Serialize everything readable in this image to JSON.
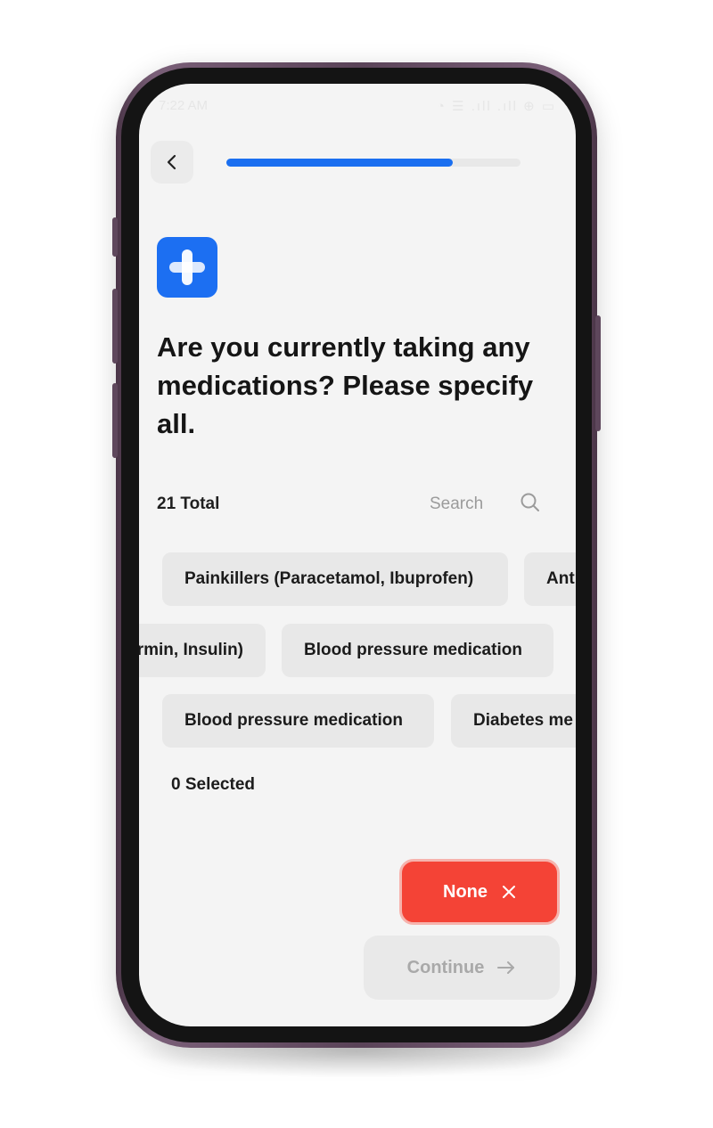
{
  "status_bar": {
    "time": "7:22 AM",
    "icons": "◔ ☰ .ıll .ıll ⊕ ▭"
  },
  "header": {
    "back_icon": "chevron-left-icon",
    "progress_fraction": 0.77
  },
  "question": {
    "icon": "medical-cross-icon",
    "text": "Are you currently taking any medications? Please specify all."
  },
  "list_header": {
    "total_label": "21 Total",
    "search_placeholder": "Search",
    "search_icon": "search-icon"
  },
  "chips": {
    "row1": [
      "Painkillers (Paracetamol, Ibuprofen)",
      "Ant"
    ],
    "row2": [
      "rmin, Insulin)",
      "Blood pressure medication"
    ],
    "row3": [
      "Blood pressure medication",
      "Diabetes me"
    ]
  },
  "selection": {
    "count_label": "0 Selected"
  },
  "actions": {
    "none_label": "None",
    "none_icon": "close-icon",
    "continue_label": "Continue",
    "continue_icon": "arrow-right-icon"
  },
  "colors": {
    "accent": "#1a6ff0",
    "none_button": "#f44336",
    "screen_bg": "#f4f4f4",
    "chip_bg": "#e8e8e8"
  }
}
